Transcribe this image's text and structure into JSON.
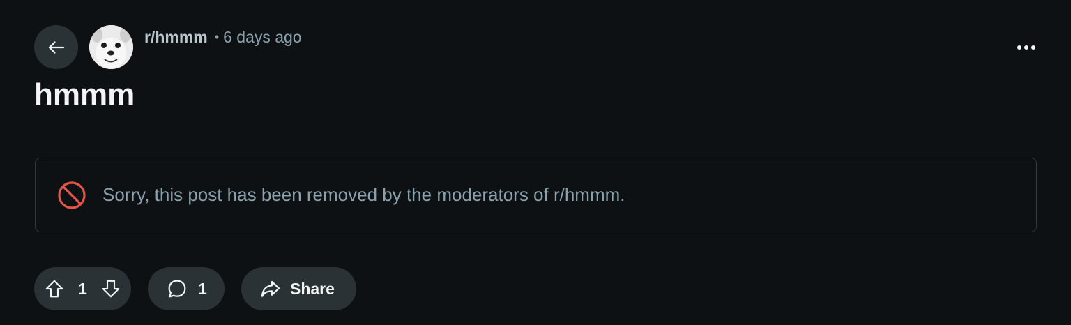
{
  "post": {
    "subreddit": "r/hmmm",
    "separator": "•",
    "time_ago": "6 days ago",
    "title": "hmmm",
    "removed_message": "Sorry, this post has been removed by the moderators of r/hmmm."
  },
  "actions": {
    "vote_count": "1",
    "comment_count": "1",
    "share_label": "Share"
  },
  "icons": {
    "back": "arrow-left-icon",
    "more": "more-horizontal-icon",
    "removed": "ban-icon",
    "upvote": "arrow-up-icon",
    "downvote": "arrow-down-icon",
    "comment": "comment-icon",
    "share": "share-icon"
  },
  "colors": {
    "background": "#0e1113",
    "button_bg": "#2a3236",
    "ban_red": "#e6554a",
    "muted_text": "#8ba2ad"
  }
}
